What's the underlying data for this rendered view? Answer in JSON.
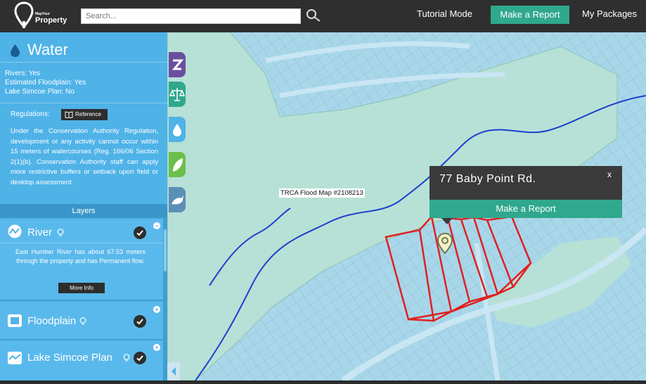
{
  "header": {
    "logo_line1": "MapYour",
    "logo_line2": "Property",
    "search_placeholder": "Search...",
    "nav": {
      "tutorial": "Tutorial Mode",
      "make_report": "Make a Report",
      "packages": "My Packages"
    }
  },
  "panel": {
    "title": "Water",
    "facts": [
      "Rivers: Yes",
      "Estimated Floodplain: Yes",
      "Lake Simcoe Plan: No"
    ],
    "regulations_label": "Regulations:",
    "reference_button": "Reference",
    "regulations_text": "Under the Conservation Authority Regulation, development or any activity cannot occur within 15 meters of watercourses (Reg. 166/06 Section 2(1)(b). Conservation Authority staff can apply more restrictive buffers or setback upon field or desktop assessment."
  },
  "layers": {
    "heading": "Layers",
    "items": [
      {
        "name": "River",
        "description": "East Humber River has about 67.53 meters through the property and has Permanent flow.",
        "more_button": "More Info",
        "toggle": "−"
      },
      {
        "name": "Floodplain",
        "toggle": "+"
      },
      {
        "name": "Lake Simcoe Plan",
        "toggle": "+"
      }
    ]
  },
  "map": {
    "flood_label": "TRCA Flood Map #2108213",
    "popup": {
      "address": "77 Baby Point Rd.",
      "close": "x",
      "button": "Make a Report"
    }
  },
  "colors": {
    "header_bg": "#2f2f2f",
    "accent_green": "#2fa88e",
    "sidebar_blue": "#4fb3e8",
    "parcel_red": "#e02020",
    "river_blue": "#1f3fcf",
    "floodplain": "#b7e1d6"
  },
  "icons": [
    "logo-pin-icon",
    "search-icon",
    "water-drop-icon",
    "book-icon",
    "river-icon",
    "floodplain-icon",
    "lake-icon",
    "bulb-icon",
    "check-icon",
    "zoning-icon",
    "scales-icon",
    "leaf-icon",
    "wildlife-icon",
    "map-marker-icon"
  ]
}
